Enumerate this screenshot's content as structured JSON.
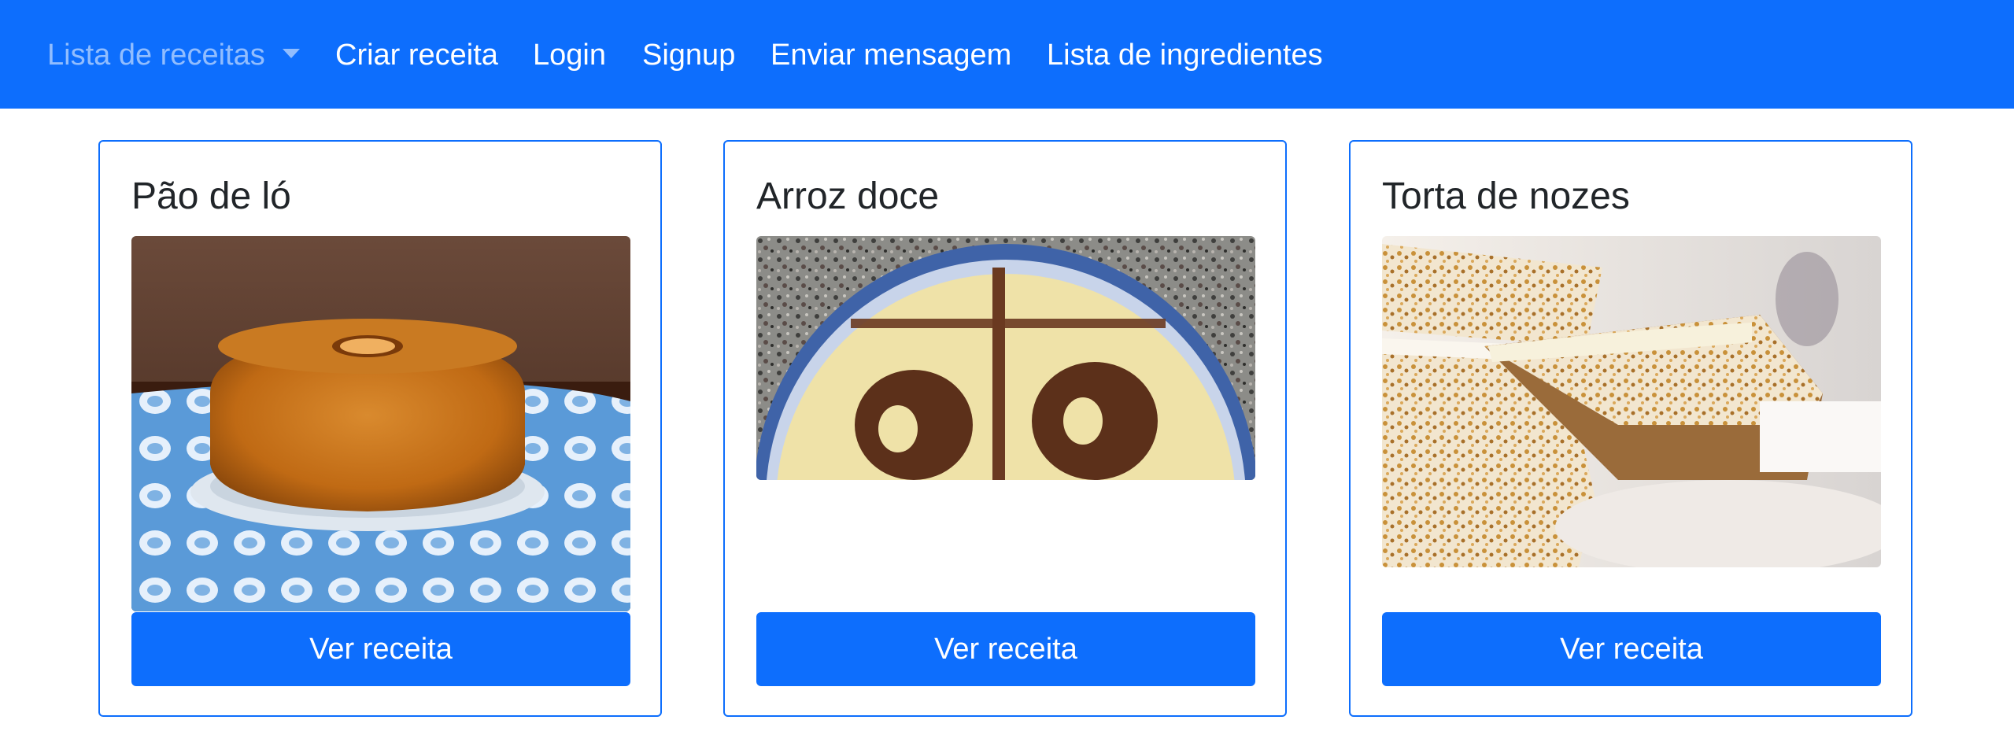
{
  "navbar": {
    "background": "#0d6efd",
    "items": [
      {
        "label": "Lista de receitas",
        "dropdown": true
      },
      {
        "label": "Criar receita"
      },
      {
        "label": "Login"
      },
      {
        "label": "Signup"
      },
      {
        "label": "Enviar mensagem"
      },
      {
        "label": "Lista de ingredientes"
      }
    ]
  },
  "recipes": [
    {
      "title": "Pão de ló",
      "button_label": "Ver receita",
      "image": "pao-de-lo-photo"
    },
    {
      "title": "Arroz doce",
      "button_label": "Ver receita",
      "image": "arroz-doce-photo"
    },
    {
      "title": "Torta de nozes",
      "button_label": "Ver receita",
      "image": "torta-de-nozes-photo"
    }
  ],
  "colors": {
    "primary": "#0d6efd",
    "text": "#212529"
  }
}
